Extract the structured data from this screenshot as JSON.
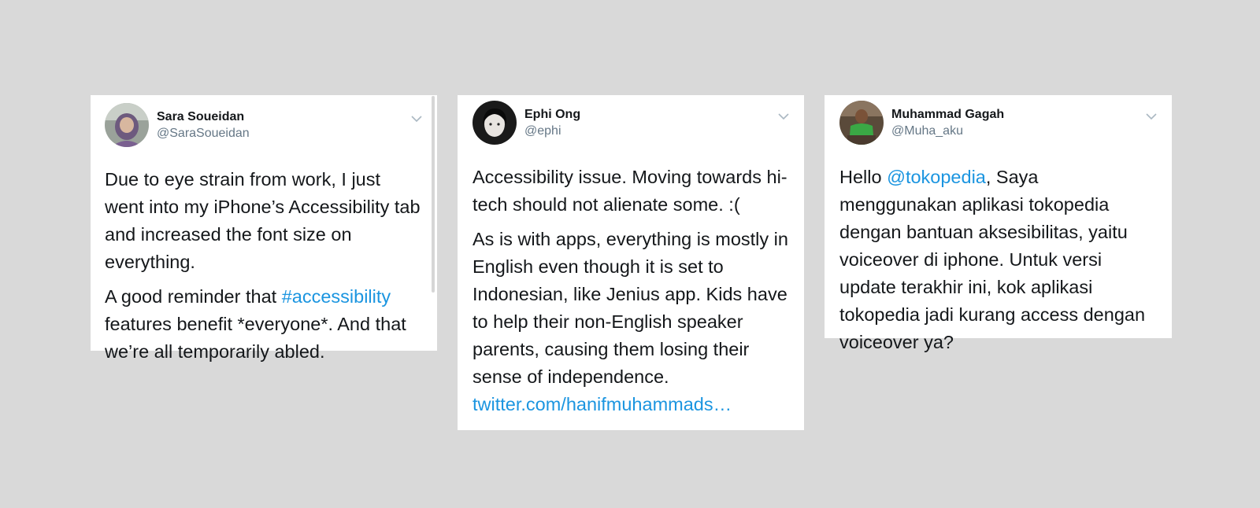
{
  "colors": {
    "background": "#d9d9d9",
    "card": "#ffffff",
    "text": "#14171a",
    "handle": "#657786",
    "link": "#1b95e0"
  },
  "tweets": [
    {
      "name": "Sara Soueidan",
      "handle": "@SaraSoueidan",
      "avatar_icon": "avatar-photo",
      "menu_icon": "chevron-down-icon",
      "p1": "Due to eye strain from work, I just went into my iPhone’s Accessibility tab and increased the font size on everything.",
      "p2_before": "A good reminder that ",
      "p2_link": "#accessibility",
      "p2_after": " features benefit *everyone*. And that we’re all temporarily abled."
    },
    {
      "name": "Ephi Ong",
      "handle": "@ephi",
      "avatar_icon": "avatar-photo",
      "menu_icon": "chevron-down-icon",
      "p1": "Accessibility issue. Moving towards hi-tech should not alienate some. :(",
      "p2_before": "As is with apps, everything is mostly in English even though it is set to Indonesian, like Jenius app. Kids have to help their non-English speaker parents, causing them losing their sense of independence. ",
      "p2_link": "twitter.com/hanifmuhammads…"
    },
    {
      "name": "Muhammad Gagah",
      "handle": "@Muha_aku",
      "avatar_icon": "avatar-photo",
      "menu_icon": "chevron-down-icon",
      "p1_before": "Hello ",
      "p1_link": "@tokopedia",
      "p1_after": ", Saya menggunakan aplikasi tokopedia dengan bantuan aksesibilitas, yaitu voiceover di iphone. Untuk versi update terakhir ini, kok aplikasi tokopedia jadi kurang access dengan voiceover ya?"
    }
  ]
}
